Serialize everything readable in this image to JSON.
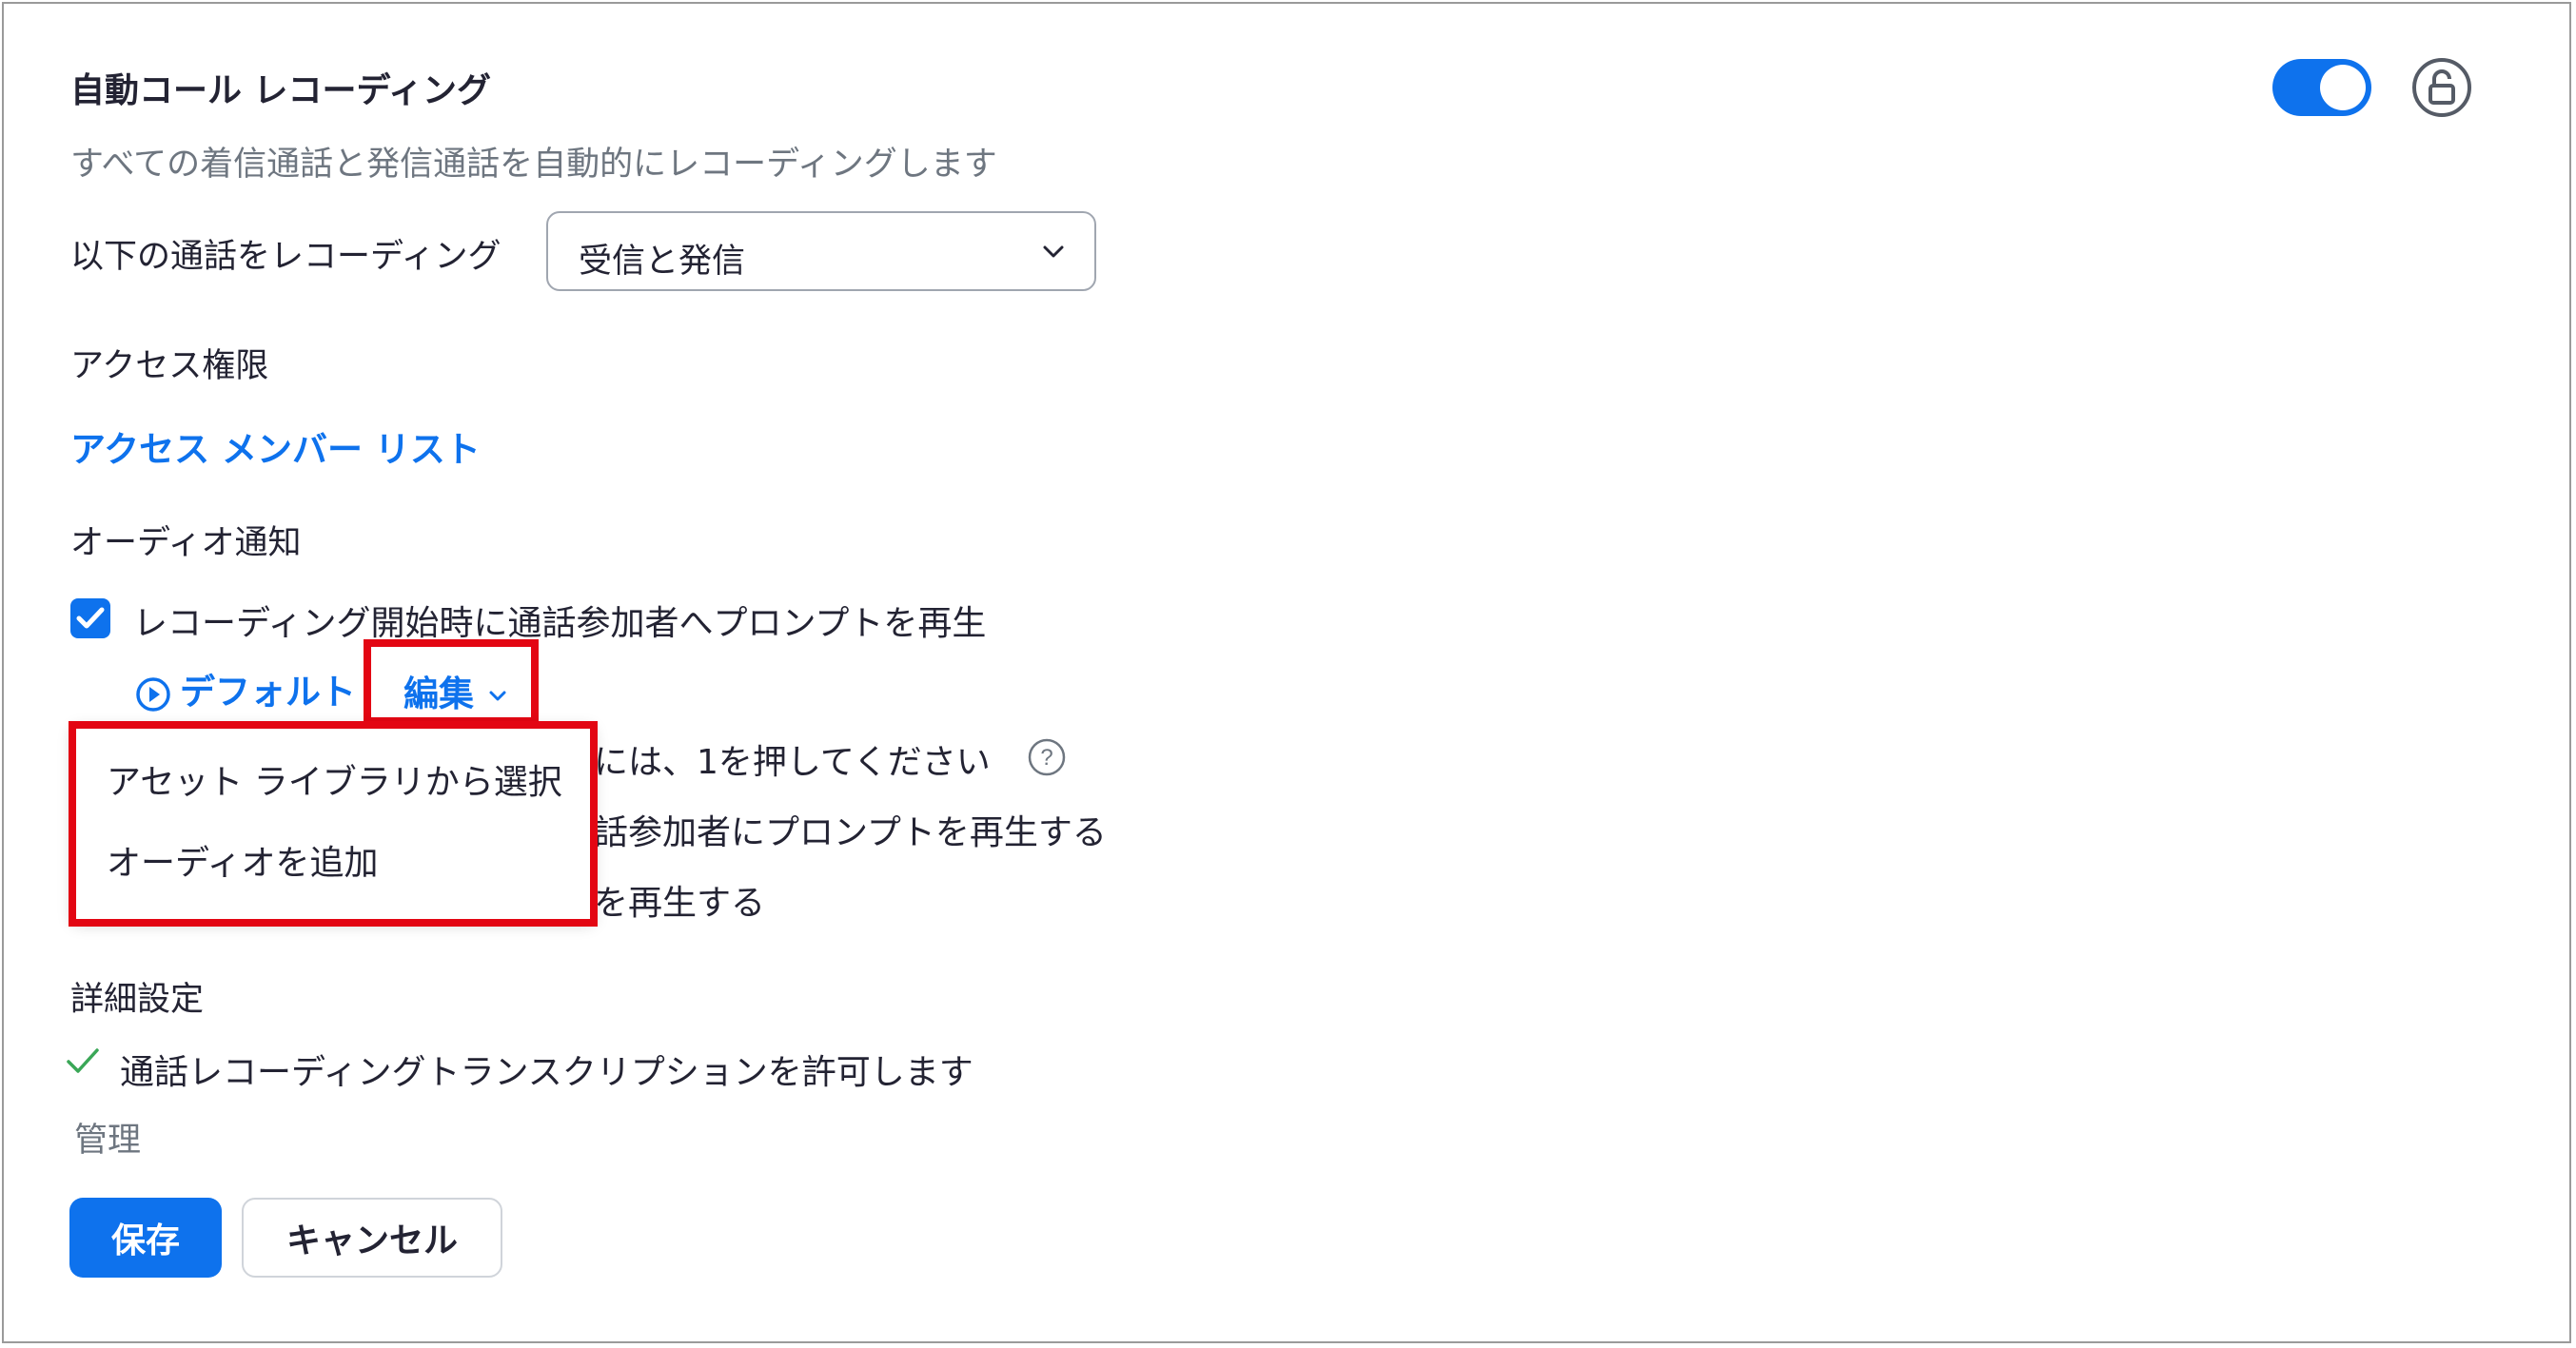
{
  "header": {
    "title": "自動コール レコーディング",
    "subtitle": "すべての着信通話と発信通話を自動的にレコーディングします",
    "toggle_on": true
  },
  "record_calls": {
    "label": "以下の通話をレコーディング",
    "selected": "受信と発信"
  },
  "access": {
    "label": "アクセス権限",
    "member_list_link": "アクセス メンバー リスト"
  },
  "audio_notice": {
    "label": "オーディオ通知",
    "play_prompt_label": "レコーディング開始時に通話参加者へプロンプトを再生",
    "play_prompt_checked": true,
    "default_label": "デフォルト",
    "edit_label": "編集",
    "obscured_option_1": "には、1を押してください",
    "obscured_option_2": "話参加者にプロンプトを再生する",
    "obscured_option_3": "を再生する"
  },
  "edit_menu": {
    "items": [
      "アセット ライブラリから選択",
      "オーディオを追加"
    ]
  },
  "advanced": {
    "label": "詳細設定",
    "transcription_label": "通話レコーディングトランスクリプションを許可します"
  },
  "admin": {
    "label": "管理"
  },
  "actions": {
    "save_label": "保存",
    "cancel_label": "キャンセル"
  },
  "colors": {
    "accent": "#0e72ed",
    "highlight": "#e30613",
    "check_green": "#3aa757"
  }
}
